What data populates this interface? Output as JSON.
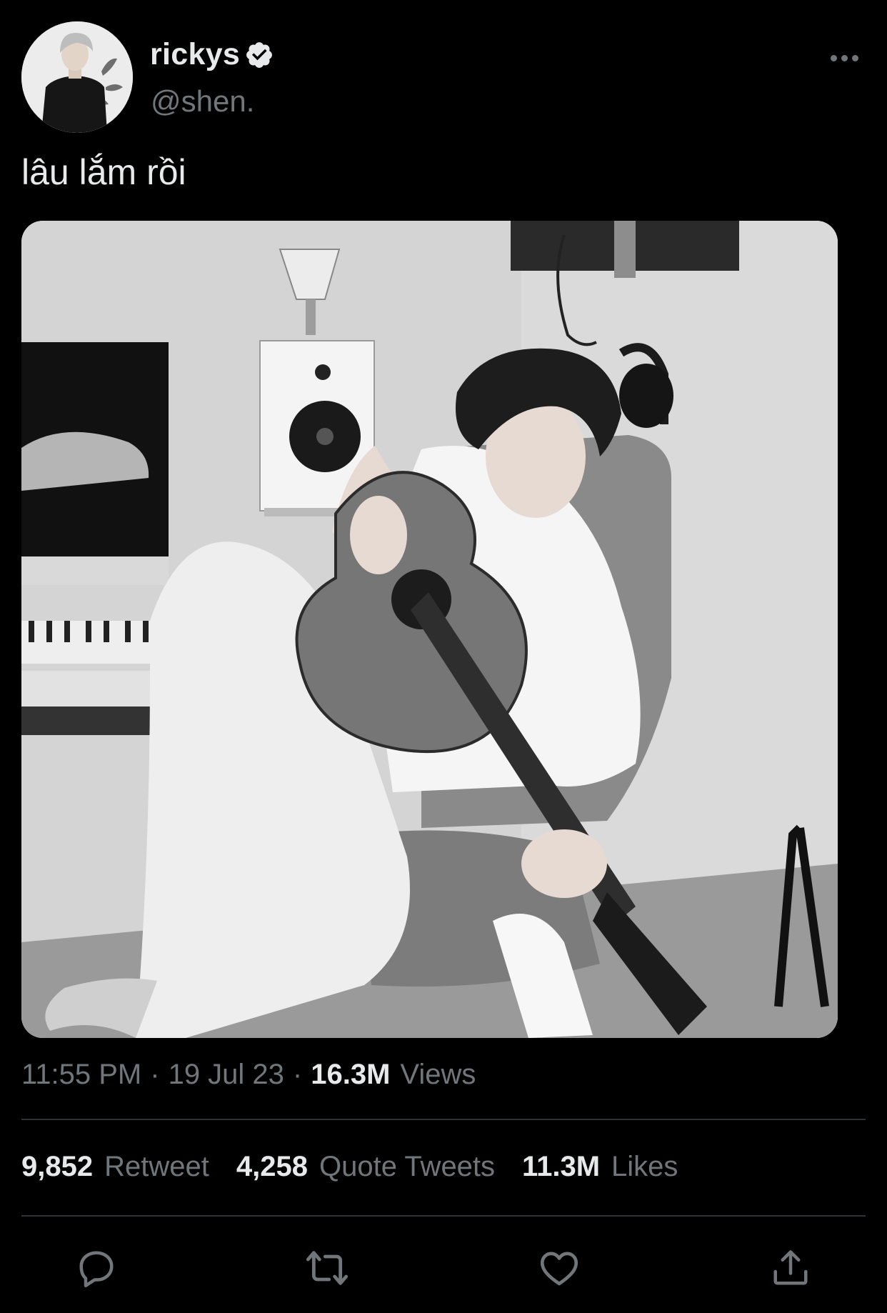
{
  "author": {
    "display_name": "rickys",
    "handle": "@shen.",
    "verified": true
  },
  "tweet": {
    "text": "lâu lắm rồi",
    "time": "11:55 PM",
    "date": "19 Jul 23",
    "separator": "·",
    "views_count": "16.3M",
    "views_label": "Views"
  },
  "stats": [
    {
      "count": "9,852",
      "label": "Retweet"
    },
    {
      "count": "4,258",
      "label": "Quote Tweets"
    },
    {
      "count": "11.3M",
      "label": "Likes"
    }
  ],
  "icons": {
    "more": "more-horizontal-icon",
    "verified": "verified-badge-icon",
    "reply": "reply-icon",
    "retweet": "retweet-icon",
    "like": "heart-icon",
    "share": "share-icon"
  },
  "colors": {
    "background": "#000000",
    "text": "#e7e9ea",
    "muted": "#71767b",
    "divider": "#2f3336"
  }
}
